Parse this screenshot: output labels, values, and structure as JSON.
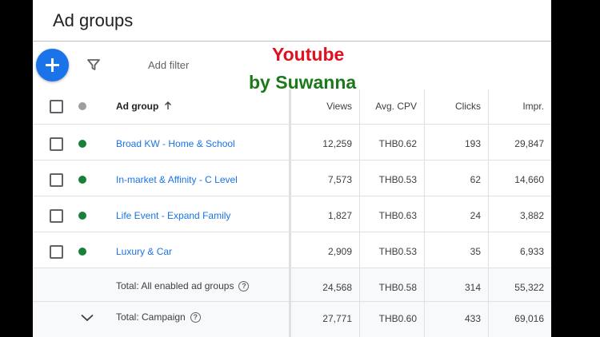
{
  "page_title": "Ad groups",
  "toolbar": {
    "add_filter_label": "Add filter"
  },
  "watermark": {
    "line1": "Youtube",
    "line2": "by Suwanna"
  },
  "table": {
    "columns": {
      "ad_group": "Ad group",
      "views": "Views",
      "avg_cpv": "Avg. CPV",
      "clicks": "Clicks",
      "impr": "Impr."
    },
    "rows": [
      {
        "name": "Broad KW - Home & School",
        "views": "12,259",
        "avg_cpv": "THB0.62",
        "clicks": "193",
        "impr": "29,847",
        "status": "enabled"
      },
      {
        "name": "In-market & Affinity - C Level",
        "views": "7,573",
        "avg_cpv": "THB0.53",
        "clicks": "62",
        "impr": "14,660",
        "status": "enabled"
      },
      {
        "name": "Life Event - Expand Family",
        "views": "1,827",
        "avg_cpv": "THB0.63",
        "clicks": "24",
        "impr": "3,882",
        "status": "enabled"
      },
      {
        "name": "Luxury & Car",
        "views": "2,909",
        "avg_cpv": "THB0.53",
        "clicks": "35",
        "impr": "6,933",
        "status": "enabled"
      }
    ],
    "totals": [
      {
        "label": "Total: All enabled ad groups",
        "views": "24,568",
        "avg_cpv": "THB0.58",
        "clicks": "314",
        "impr": "55,322"
      },
      {
        "label": "Total: Campaign",
        "views": "27,771",
        "avg_cpv": "THB0.60",
        "clicks": "433",
        "impr": "69,016"
      }
    ]
  },
  "colors": {
    "accent": "#1a73e8",
    "status_enabled": "#188038",
    "status_header": "#9e9e9e"
  },
  "icons": [
    "add-icon",
    "filter-icon",
    "sort-arrow-up-icon",
    "help-icon",
    "chevron-down-icon"
  ]
}
